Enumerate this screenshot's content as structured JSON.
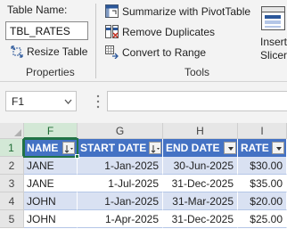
{
  "ribbon": {
    "properties": {
      "table_name_label": "Table Name:",
      "table_name_value": "TBL_RATES",
      "resize_label": "Resize Table",
      "group_title": "Properties"
    },
    "tools": {
      "summarize_label": "Summarize with PivotTable",
      "remove_duplicates_label": "Remove Duplicates",
      "convert_label": "Convert to Range",
      "group_title": "Tools"
    },
    "insert_slicer": {
      "line1": "Insert",
      "line2": "Slicer"
    }
  },
  "formula_bar": {
    "name_box": "F1",
    "formula": ""
  },
  "grid": {
    "columns": [
      "F",
      "G",
      "H",
      "I"
    ],
    "rows": [
      "1",
      "2",
      "3",
      "4",
      "5"
    ],
    "table_headers": [
      "NAME",
      "START DATE",
      "END DATE",
      "RATE"
    ],
    "table_rows": [
      [
        "JANE",
        "1-Jan-2025",
        "30-Jun-2025",
        "$30.00"
      ],
      [
        "JANE",
        "1-Jul-2025",
        "31-Dec-2025",
        "$35.00"
      ],
      [
        "JOHN",
        "1-Jan-2025",
        "31-Mar-2025",
        "$20.00"
      ],
      [
        "JOHN",
        "1-Apr-2025",
        "31-Dec-2025",
        "$25.00"
      ]
    ]
  },
  "colors": {
    "header_blue": "#4472c4",
    "band_light_blue": "#d9e1f2",
    "selection_green": "#217346"
  }
}
